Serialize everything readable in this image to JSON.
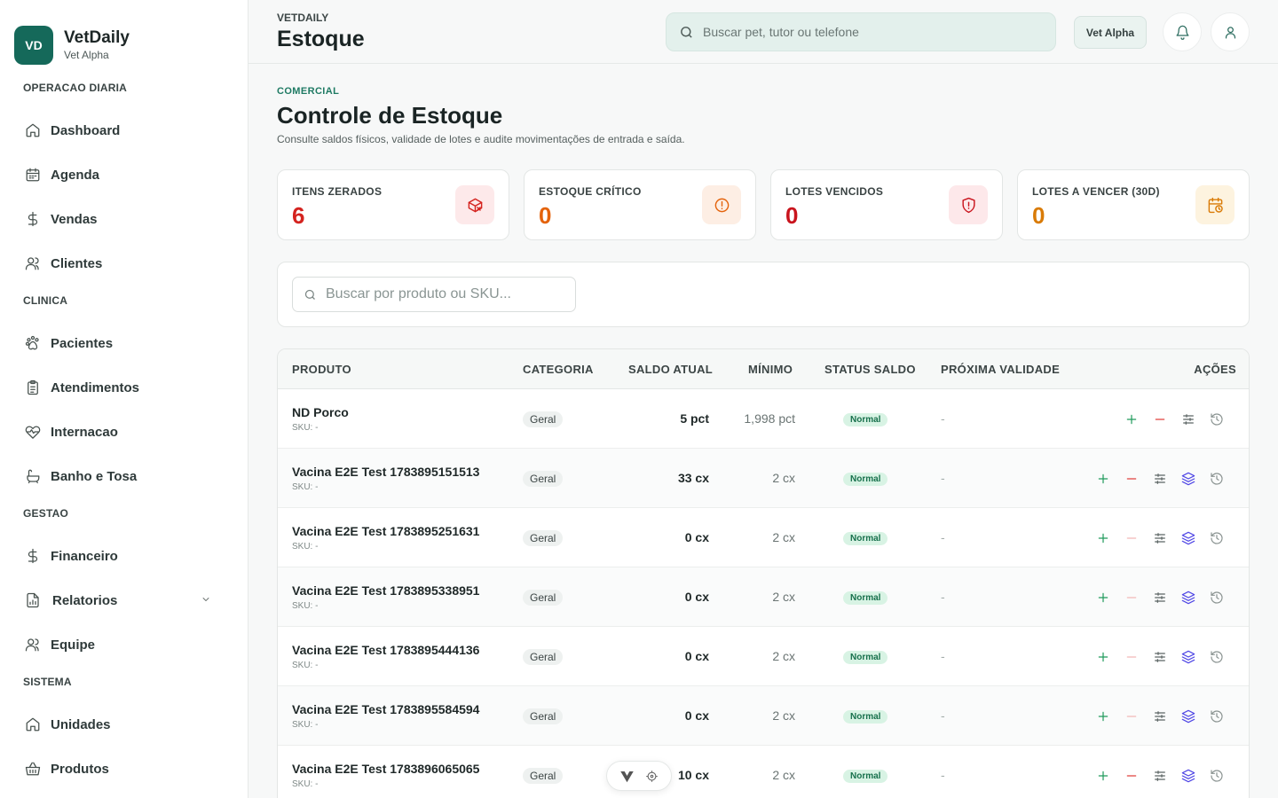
{
  "brand": {
    "logo": "VD",
    "name": "VetDaily",
    "sub": "Vet Alpha"
  },
  "sidebar": {
    "sections": [
      {
        "title": "OPERACAO DIARIA",
        "items": [
          {
            "label": "Dashboard",
            "icon": "home-icon"
          },
          {
            "label": "Agenda",
            "icon": "calendar-icon"
          },
          {
            "label": "Vendas",
            "icon": "dollar-icon"
          },
          {
            "label": "Clientes",
            "icon": "users-icon"
          }
        ]
      },
      {
        "title": "CLINICA",
        "items": [
          {
            "label": "Pacientes",
            "icon": "paw-icon"
          },
          {
            "label": "Atendimentos",
            "icon": "clipboard-icon"
          },
          {
            "label": "Internacao",
            "icon": "heart-pulse-icon"
          },
          {
            "label": "Banho e Tosa",
            "icon": "bath-icon"
          }
        ]
      },
      {
        "title": "GESTAO",
        "items": [
          {
            "label": "Financeiro",
            "icon": "dollar-icon"
          },
          {
            "label": "Relatorios",
            "icon": "report-icon"
          },
          {
            "label": "Equipe",
            "icon": "users-icon"
          }
        ]
      },
      {
        "title": "SISTEMA",
        "items": [
          {
            "label": "Unidades",
            "icon": "home-icon"
          },
          {
            "label": "Produtos",
            "icon": "basket-icon"
          }
        ]
      }
    ]
  },
  "header": {
    "kicker": "VETDAILY",
    "title": "Estoque",
    "search_placeholder": "Buscar pet, tutor ou telefone",
    "unit_chip": "Vet Alpha"
  },
  "page": {
    "kicker": "COMERCIAL",
    "title": "Controle de Estoque",
    "subtitle": "Consulte saldos físicos, validade de lotes e audite movimentações de entrada e saída."
  },
  "stats": [
    {
      "label": "ITENS ZERADOS",
      "value": "6",
      "color": "#d4231f",
      "bg": "#fde9ea",
      "icon": "package-x-icon"
    },
    {
      "label": "ESTOQUE CRÍTICO",
      "value": "0",
      "color": "#e4630c",
      "bg": "#fdeee4",
      "icon": "alert-circle-icon"
    },
    {
      "label": "LOTES VENCIDOS",
      "value": "0",
      "color": "#c9141d",
      "bg": "#fde8ea",
      "icon": "shield-alert-icon"
    },
    {
      "label": "LOTES A VENCER (30D)",
      "value": "0",
      "color": "#d97b07",
      "bg": "#fdf3df",
      "icon": "calendar-clock-icon"
    }
  ],
  "filter": {
    "search_placeholder": "Buscar por produto ou SKU..."
  },
  "table": {
    "headers": {
      "produto": "PRODUTO",
      "categoria": "CATEGORIA",
      "saldo": "SALDO ATUAL",
      "minimo": "MÍNIMO",
      "status": "STATUS SALDO",
      "validade": "PRÓXIMA VALIDADE",
      "acoes": "AÇÕES"
    },
    "rows": [
      {
        "name": "ND Porco",
        "sku": "SKU:  -",
        "category": "Geral",
        "saldo": "5 pct",
        "minimo": "1,998 pct",
        "status": "Normal",
        "validade": "-",
        "has_lots": false,
        "minus_active": true
      },
      {
        "name": "Vacina E2E Test 1783895151513",
        "sku": "SKU:  -",
        "category": "Geral",
        "saldo": "33 cx",
        "minimo": "2 cx",
        "status": "Normal",
        "validade": "-",
        "has_lots": true,
        "minus_active": true
      },
      {
        "name": "Vacina E2E Test 1783895251631",
        "sku": "SKU:  -",
        "category": "Geral",
        "saldo": "0 cx",
        "minimo": "2 cx",
        "status": "Normal",
        "validade": "-",
        "has_lots": true,
        "minus_active": false
      },
      {
        "name": "Vacina E2E Test 1783895338951",
        "sku": "SKU:  -",
        "category": "Geral",
        "saldo": "0 cx",
        "minimo": "2 cx",
        "status": "Normal",
        "validade": "-",
        "has_lots": true,
        "minus_active": false
      },
      {
        "name": "Vacina E2E Test 1783895444136",
        "sku": "SKU:  -",
        "category": "Geral",
        "saldo": "0 cx",
        "minimo": "2 cx",
        "status": "Normal",
        "validade": "-",
        "has_lots": true,
        "minus_active": false
      },
      {
        "name": "Vacina E2E Test 1783895584594",
        "sku": "SKU:  -",
        "category": "Geral",
        "saldo": "0 cx",
        "minimo": "2 cx",
        "status": "Normal",
        "validade": "-",
        "has_lots": true,
        "minus_active": false
      },
      {
        "name": "Vacina E2E Test 1783896065065",
        "sku": "SKU:  -",
        "category": "Geral",
        "saldo": "10 cx",
        "minimo": "2 cx",
        "status": "Normal",
        "validade": "-",
        "has_lots": true,
        "minus_active": true
      }
    ]
  },
  "colors": {
    "brand": "#15695a",
    "plus": "#1f9a5b",
    "minus": "#e0413d",
    "minus_disabled": "#f2b8b6",
    "layers": "#4f46e5",
    "neutral_icon": "#5b6463"
  }
}
